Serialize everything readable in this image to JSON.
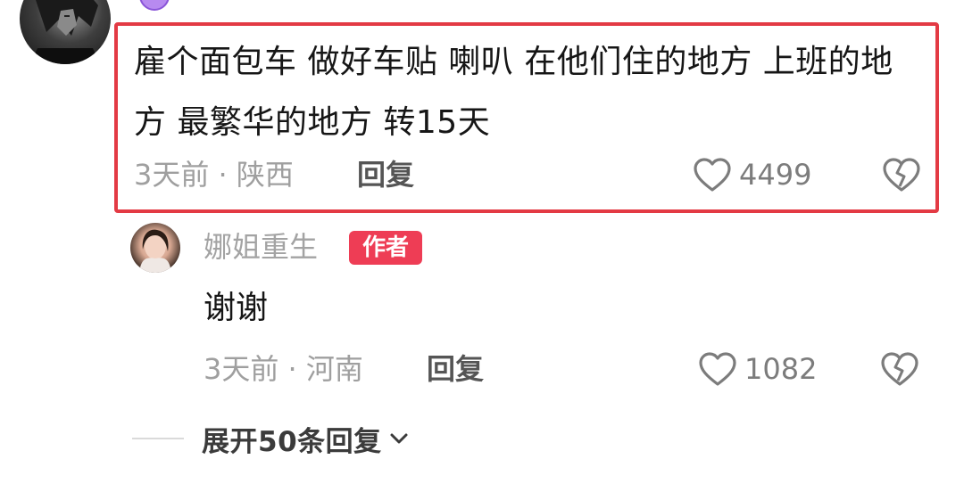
{
  "comment": {
    "text": "雇个面包车 做好车贴 喇叭 在他们住的地方 上班的地方 最繁华的地方 转15天",
    "time_location": "3天前 · 陕西",
    "reply_label": "回复",
    "like_count": "4499"
  },
  "reply": {
    "username": "娜姐重生",
    "badge": "作者",
    "text": "谢谢",
    "time_location": "3天前 · 河南",
    "reply_label": "回复",
    "like_count": "1082"
  },
  "expand": {
    "label": "展开50条回复"
  },
  "colors": {
    "highlight_border": "#e33a44",
    "author_badge": "#ee3d55",
    "meta_text": "#9f9f9f"
  },
  "icons": {
    "like": "heart-outline-icon",
    "dislike": "broken-heart-icon",
    "expand": "chevron-down-icon"
  }
}
